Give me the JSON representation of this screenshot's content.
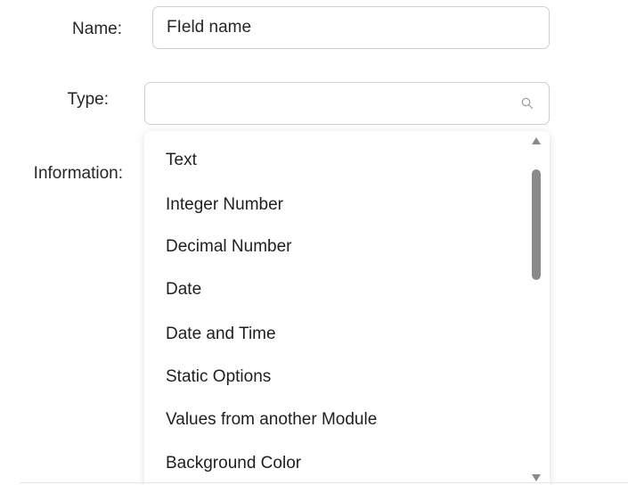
{
  "form": {
    "name_label": "Name:",
    "name_value": "FIeld name",
    "type_label": "Type:",
    "type_value": "",
    "information_label": "Information:"
  },
  "dropdown": {
    "options": [
      "Text",
      "Integer Number",
      "Decimal Number",
      "Date",
      "Date and Time",
      "Static Options",
      "Values from another Module",
      "Background Color"
    ]
  },
  "icons": {
    "search": "search-icon",
    "scroll_up": "scroll-up-arrow-icon",
    "scroll_down": "scroll-down-arrow-icon"
  }
}
